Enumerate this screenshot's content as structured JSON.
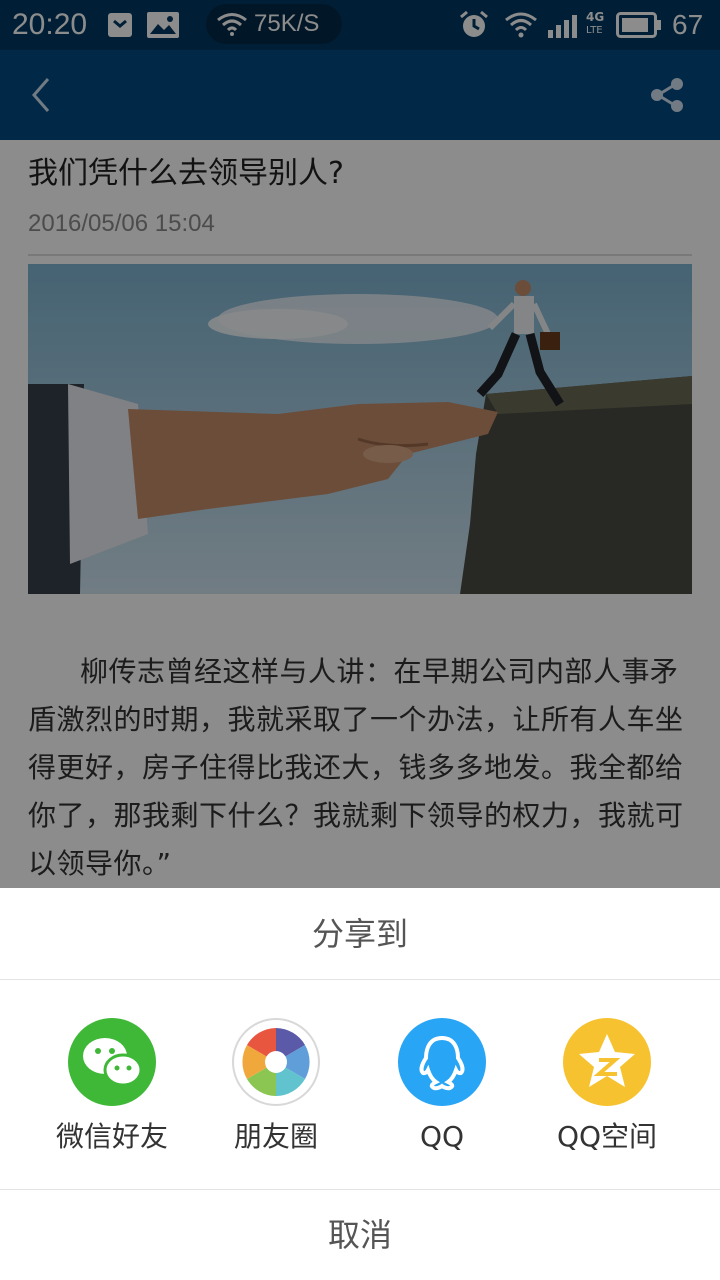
{
  "status_bar": {
    "time": "20:20",
    "net_speed": "75K/S",
    "network_type": "4G",
    "network_sub": "LTE",
    "battery": "67",
    "icons": [
      "vpn-shield-icon",
      "image-notification-icon",
      "wifi-icon",
      "alarm-icon",
      "wifi-icon",
      "signal-icon",
      "battery-icon"
    ]
  },
  "nav": {
    "back_icon": "chevron-left-icon",
    "share_icon": "share-icon"
  },
  "article": {
    "title": "我们凭什么去领导别人?",
    "date": "2016/05/06 15:04",
    "paragraph": "柳传志曾经这样与人讲：在早期公司内部人事矛盾激烈的时期，我就采取了一个办法，让所有人车坐得更好，房子住得比我还大，钱多多地发。我全都给你了，那我剩下什么？我就剩下领导的权力，我就可以领导你。”"
  },
  "share_sheet": {
    "title": "分享到",
    "options": [
      {
        "label": "微信好友",
        "icon": "wechat-icon",
        "color": "#3fb838"
      },
      {
        "label": "朋友圈",
        "icon": "moments-icon",
        "color": "#ffffff"
      },
      {
        "label": "QQ",
        "icon": "qq-icon",
        "color": "#29a5f5"
      },
      {
        "label": "QQ空间",
        "icon": "qzone-icon",
        "color": "#f6c22f"
      }
    ],
    "cancel": "取消"
  },
  "colors": {
    "status_bar_bg": "#013a63",
    "nav_bg": "#024b82",
    "overlay": "rgba(0,0,0,0.45)"
  }
}
